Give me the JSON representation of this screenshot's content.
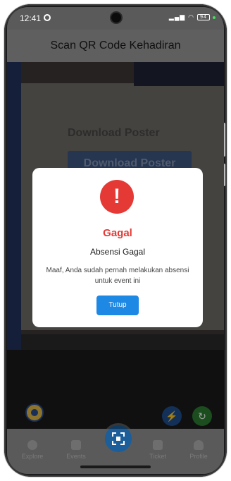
{
  "status_bar": {
    "time": "12:41",
    "battery": "94"
  },
  "app_bar": {
    "title": "Scan QR Code Kehadiran"
  },
  "camera_view": {
    "text": "Download Poster",
    "button_text": "Download Poster"
  },
  "dialog": {
    "title": "Gagal",
    "subtitle": "Absensi Gagal",
    "message": "Maaf, Anda sudah pernah melakukan absensi untuk event ini",
    "button_label": "Tutup",
    "accent_color": "#e53935",
    "button_color": "#1e88e5"
  },
  "bottom_nav": {
    "items": [
      {
        "label": "Explore",
        "icon": "explore-icon"
      },
      {
        "label": "Events",
        "icon": "calendar-icon"
      },
      {
        "label": "Ticket",
        "icon": "ticket-icon"
      },
      {
        "label": "Profile",
        "icon": "person-icon"
      }
    ],
    "center_icon": "qr-scan-icon"
  },
  "floating": {
    "flash_icon": "flash-icon",
    "switch_camera_icon": "switch-camera-icon"
  }
}
